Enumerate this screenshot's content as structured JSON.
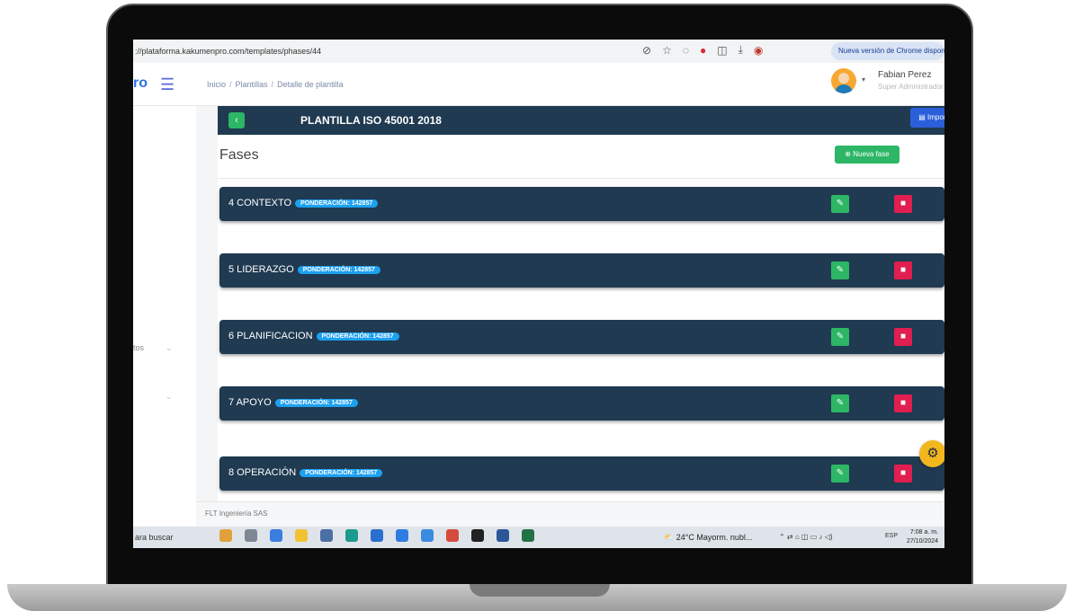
{
  "browser": {
    "url": "://plataforma.kakumenpro.com/templates/phases/44",
    "chrome_update_badge": "Nueva versión de Chrome disponible"
  },
  "header": {
    "brand": "ro",
    "breadcrumb": [
      "Inicio",
      "Plantillas",
      "Detalle de plantilla"
    ],
    "user_name": "Fabian Perez",
    "user_role": "Super Administrador"
  },
  "sidebar": {
    "partial_label": "tos"
  },
  "template": {
    "title": "PLANTILLA ISO 45001 2018",
    "import_label": "Importar"
  },
  "phases": {
    "title": "Fases",
    "new_phase_label": "Nueva fase",
    "items": [
      {
        "name": "4 CONTEXTO",
        "badge": "PONDERACIÓN: 142857"
      },
      {
        "name": "5 LIDERAZGO",
        "badge": "PONDERACIÓN: 142857"
      },
      {
        "name": "6 PLANIFICACION",
        "badge": "PONDERACIÓN: 142857"
      },
      {
        "name": "7 APOYO",
        "badge": "PONDERACIÓN: 142857"
      },
      {
        "name": "8 OPERACIÓN",
        "badge": "PONDERACIÓN: 142857"
      }
    ]
  },
  "footer": {
    "company": "FLT Ingeniería SAS"
  },
  "taskbar": {
    "search": "ara buscar",
    "weather": "24°C Mayorm. nubl...",
    "lang": "ESP",
    "time": "7:08 a. m.",
    "date": "27/10/2024"
  },
  "colors": {
    "dark_header": "#1f3a51",
    "success": "#2db665",
    "danger": "#e01e4f",
    "badge": "#1ea0f0",
    "primary": "#2b5fd9"
  }
}
